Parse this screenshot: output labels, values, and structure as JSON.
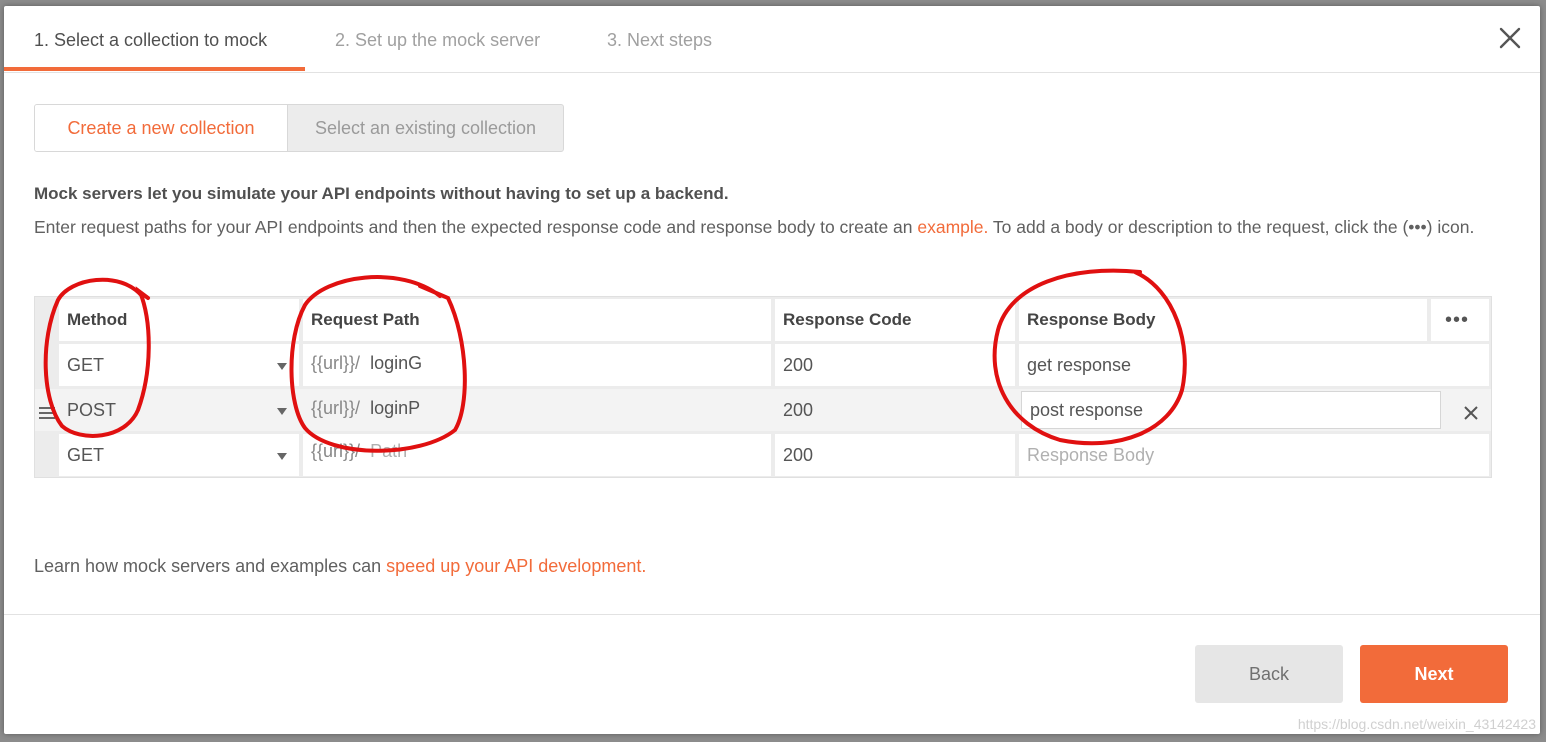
{
  "steps": [
    {
      "label": "1. Select a collection to mock"
    },
    {
      "label": "2. Set up the mock server"
    },
    {
      "label": "3. Next steps"
    }
  ],
  "toggle": {
    "selected": "Create a new collection",
    "other": "Select an existing collection"
  },
  "intro": {
    "bold": "Mock servers let you simulate your API endpoints without having to set up a backend.",
    "text_before": "Enter request paths for your API endpoints and then the expected response code and response body to create an ",
    "link": "example.",
    "text_after": " To add a body or description to the request, click the (•••) icon."
  },
  "table": {
    "headers": [
      "Method",
      "Request Path",
      "Response Code",
      "Response Body"
    ],
    "more_icon": "•••",
    "rows": [
      {
        "method": "GET",
        "path_prefix": "{{url}}/",
        "path": "loginG",
        "code": "200",
        "body": "get response"
      },
      {
        "method": "POST",
        "path_prefix": "{{url}}/",
        "path": "loginP",
        "code": "200",
        "body": "post response"
      },
      {
        "method": "GET",
        "path_prefix": "{{url}}/",
        "path_placeholder": "Path",
        "code": "200",
        "body_placeholder": "Response Body"
      }
    ]
  },
  "learn": {
    "text": "Learn how mock servers and examples can ",
    "link": "speed up your API development."
  },
  "buttons": {
    "back": "Back",
    "next": "Next"
  },
  "watermark": "https://blog.csdn.net/weixin_43142423",
  "colors": {
    "accent": "#f26b3a",
    "annotation": "#e01010"
  }
}
